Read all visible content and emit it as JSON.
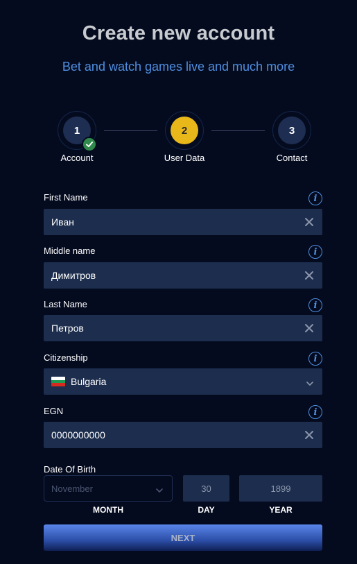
{
  "header": {
    "title": "Create new account",
    "subtitle": "Bet and watch games live and much more"
  },
  "stepper": {
    "steps": [
      {
        "number": "1",
        "label": "Account",
        "state": "completed"
      },
      {
        "number": "2",
        "label": "User Data",
        "state": "active"
      },
      {
        "number": "3",
        "label": "Contact",
        "state": "pending"
      }
    ]
  },
  "form": {
    "first_name": {
      "label": "First Name",
      "value": "Иван"
    },
    "middle_name": {
      "label": "Middle name",
      "value": "Димитров"
    },
    "last_name": {
      "label": "Last Name",
      "value": "Петров"
    },
    "citizenship": {
      "label": "Citizenship",
      "value": "Bulgaria"
    },
    "egn": {
      "label": "EGN",
      "value": "0000000000"
    },
    "dob": {
      "label": "Date Of Birth",
      "month_placeholder": "November",
      "day_value": "30",
      "year_value": "1899",
      "month_caption": "MONTH",
      "day_caption": "DAY",
      "year_caption": "YEAR"
    }
  },
  "actions": {
    "next_label": "NEXT"
  },
  "colors": {
    "background": "#050b1f",
    "input_bg": "#1c2d4d",
    "accent_blue": "#4f8fe0",
    "active_step": "#e8b71a",
    "complete_check": "#2f8a4c"
  },
  "icons": {
    "info": "info-icon",
    "clear": "close-icon",
    "dropdown": "chevron-down-icon",
    "flag": "bulgaria-flag-icon",
    "check": "check-icon"
  }
}
